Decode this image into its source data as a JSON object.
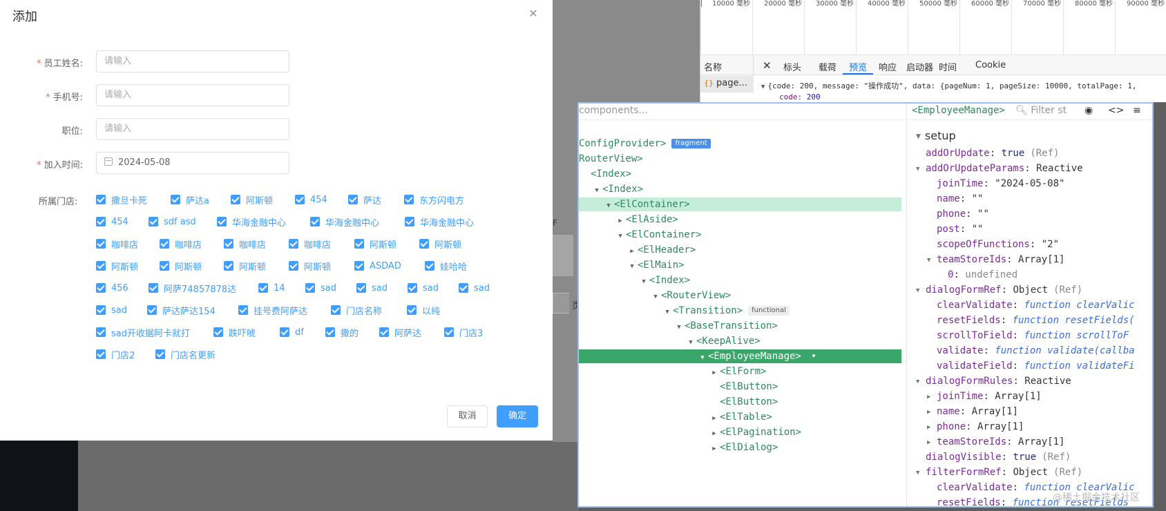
{
  "dialog": {
    "title": "添加",
    "fields": [
      {
        "label": "员工姓名:",
        "required": true,
        "placeholder": "请输入",
        "value": ""
      },
      {
        "label": "手机号:",
        "required": true,
        "placeholder": "请输入",
        "value": ""
      },
      {
        "label": "职位:",
        "required": false,
        "placeholder": "请输入",
        "value": ""
      },
      {
        "label": "加入时间:",
        "required": true,
        "placeholder": "",
        "value": "2024-05-08"
      }
    ],
    "required_mark": "*",
    "stores_label": "所属门店:",
    "stores": [
      [
        "撒旦卡死",
        "萨达a",
        "阿斯顿",
        "454",
        "萨达",
        "东方闪电方"
      ],
      [
        "454",
        "sdf asd",
        "华海金融中心",
        "华海金融中心",
        "华海金融中心"
      ],
      [
        "咖啡店",
        "咖啡店",
        "咖啡店",
        "咖啡店",
        "阿斯顿",
        "阿斯顿"
      ],
      [
        "阿斯顿",
        "阿斯顿",
        "阿斯顿",
        "阿斯顿",
        "ASDAD",
        "娃哈哈"
      ],
      [
        "456",
        "阿萨74857878达",
        "14",
        "sad",
        "sad",
        "sad",
        "sad"
      ],
      [
        "sad",
        "萨达萨达154",
        "挂号费阿萨达",
        "门店名称",
        "以纯"
      ],
      [
        "sad开收据阿卡就打",
        "跌吓唬",
        "df",
        "撒的",
        "阿萨达",
        "门店3"
      ],
      [
        "门店2",
        "门店名更新"
      ]
    ],
    "cancel_label": "取消",
    "ok_label": "确定"
  },
  "background": {
    "char_f": "F",
    "char_page": "页"
  },
  "network": {
    "timeline_ticks": [
      "10000 毫秒",
      "20000 毫秒",
      "30000 毫秒",
      "40000 毫秒",
      "50000 毫秒",
      "60000 毫秒",
      "70000 毫秒",
      "80000 毫秒",
      "90000 毫秒"
    ],
    "name_header": "名称",
    "close_symbol": "✕",
    "tabs": [
      "标头",
      "载荷",
      "预览",
      "响应",
      "启动器",
      "时间",
      "Cookie"
    ],
    "active_tab": "预览",
    "file_name": "page...",
    "response_preview": "{code: 200, message: \"操作成功\", data: {pageNum: 1, pageSize: 10000, totalPage: 1,",
    "code_key": "code:",
    "code_value": "200"
  },
  "devtools": {
    "search_placeholder": "components...",
    "selected_component": "<EmployeeManage>",
    "filter_placeholder": "Filter st",
    "fragment_badge": "fragment",
    "functional_badge": "functional",
    "selected_dot": "•",
    "tree": [
      {
        "label": "ConfigProvider>",
        "arrow": ""
      },
      {
        "label": "RouterView>",
        "arrow": ""
      },
      {
        "label": "<Index>",
        "arrow": ""
      },
      {
        "label": "<Index>",
        "arrow": "▼"
      },
      {
        "label": "<ElContainer>",
        "arrow": "▼"
      },
      {
        "label": "<ElAside>",
        "arrow": "▶"
      },
      {
        "label": "<ElContainer>",
        "arrow": "▼"
      },
      {
        "label": "<ElHeader>",
        "arrow": "▶"
      },
      {
        "label": "<ElMain>",
        "arrow": "▼"
      },
      {
        "label": "<Index>",
        "arrow": "▼"
      },
      {
        "label": "<RouterView>",
        "arrow": "▼"
      },
      {
        "label": "<Transition>",
        "arrow": "▼"
      },
      {
        "label": "<BaseTransition>",
        "arrow": "▼"
      },
      {
        "label": "<KeepAlive>",
        "arrow": "▼"
      },
      {
        "label": "<EmployeeManage>",
        "arrow": "▼"
      },
      {
        "label": "<ElForm>",
        "arrow": "▶"
      },
      {
        "label": "<ElButton>",
        "arrow": ""
      },
      {
        "label": "<ElButton>",
        "arrow": ""
      },
      {
        "label": "<ElTable>",
        "arrow": "▶"
      },
      {
        "label": "<ElPagination>",
        "arrow": "▶"
      },
      {
        "label": "<ElDialog>",
        "arrow": "▶"
      }
    ],
    "section": "setup",
    "props": [
      {
        "key": "addOrUpdate",
        "value": "true",
        "suffix": "(Ref)",
        "arrow": ""
      },
      {
        "key": "addOrUpdateParams",
        "value": "Reactive",
        "suffix": "",
        "arrow": "▼"
      },
      {
        "key": "joinTime",
        "value": "\"2024-05-08\"",
        "suffix": "",
        "arrow": ""
      },
      {
        "key": "name",
        "value": "\"\"",
        "suffix": "",
        "arrow": ""
      },
      {
        "key": "phone",
        "value": "\"\"",
        "suffix": "",
        "arrow": ""
      },
      {
        "key": "post",
        "value": "\"\"",
        "suffix": "",
        "arrow": ""
      },
      {
        "key": "scopeOfFunctions",
        "value": "\"2\"",
        "suffix": "",
        "arrow": ""
      },
      {
        "key": "teamStoreIds",
        "value": "Array[1]",
        "suffix": "",
        "arrow": "▼"
      },
      {
        "key": "0",
        "value": "undefined",
        "suffix": "",
        "arrow": ""
      },
      {
        "key": "dialogFormRef",
        "value": "Object",
        "suffix": "(Ref)",
        "arrow": "▼"
      },
      {
        "key": "clearValidate",
        "value": "function clearValic",
        "suffix": "",
        "arrow": ""
      },
      {
        "key": "resetFields",
        "value": "function resetFields(",
        "suffix": "",
        "arrow": ""
      },
      {
        "key": "scrollToField",
        "value": "function scrollToF",
        "suffix": "",
        "arrow": ""
      },
      {
        "key": "validate",
        "value": "function validate(callba",
        "suffix": "",
        "arrow": ""
      },
      {
        "key": "validateField",
        "value": "function validateFi",
        "suffix": "",
        "arrow": ""
      },
      {
        "key": "dialogFormRules",
        "value": "Reactive",
        "suffix": "",
        "arrow": "▼"
      },
      {
        "key": "joinTime",
        "value": "Array[1]",
        "suffix": "",
        "arrow": "▶"
      },
      {
        "key": "name",
        "value": "Array[1]",
        "suffix": "",
        "arrow": "▶"
      },
      {
        "key": "phone",
        "value": "Array[1]",
        "suffix": "",
        "arrow": "▶"
      },
      {
        "key": "teamStoreIds",
        "value": "Array[1]",
        "suffix": "",
        "arrow": "▶"
      },
      {
        "key": "dialogVisible",
        "value": "true",
        "suffix": "(Ref)",
        "arrow": ""
      },
      {
        "key": "filterFormRef",
        "value": "Object",
        "suffix": "(Ref)",
        "arrow": "▼"
      },
      {
        "key": "clearValidate",
        "value": "function clearValic",
        "suffix": "",
        "arrow": ""
      },
      {
        "key": "resetFields",
        "value": "function resetFields",
        "suffix": "",
        "arrow": ""
      }
    ]
  },
  "watermark": "@稀土掘金技术社区",
  "colors": {
    "primary": "#409eff",
    "danger": "#f56c6c",
    "vue_green": "#3ba66a",
    "vue_green_light": "#c5eed8"
  }
}
